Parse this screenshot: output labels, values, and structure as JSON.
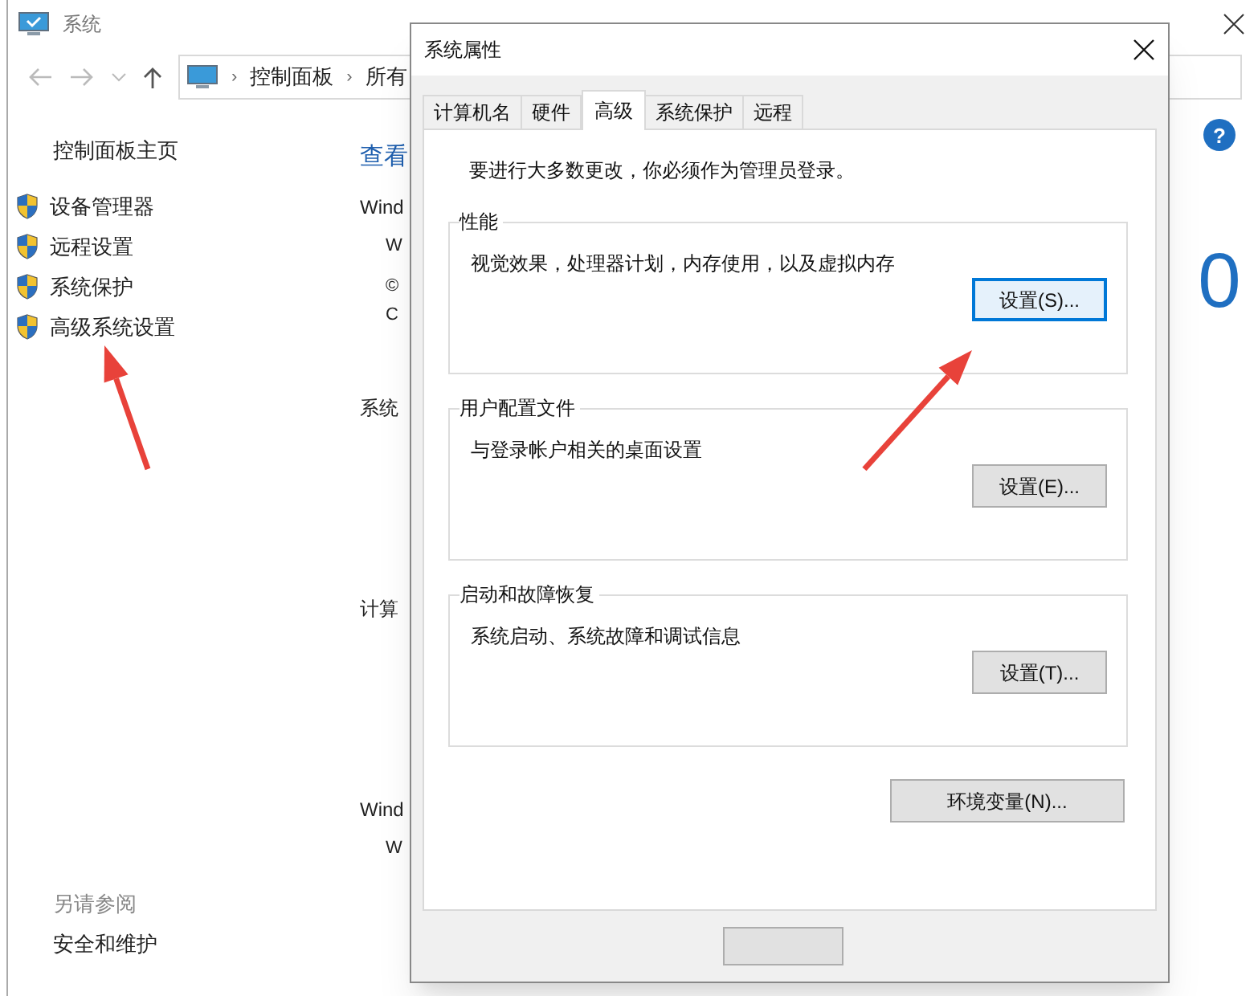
{
  "background_window": {
    "title": "系统",
    "address_bar": {
      "separator": "›",
      "path": [
        "控制面板",
        "所有"
      ]
    },
    "help_glyph": "?",
    "sidebar": {
      "home_link": "控制面板主页",
      "items": [
        {
          "label": "设备管理器"
        },
        {
          "label": "远程设置"
        },
        {
          "label": "系统保护"
        },
        {
          "label": "高级系统设置"
        }
      ],
      "see_also": {
        "heading": "另请参阅",
        "links": [
          "安全和维护"
        ]
      }
    },
    "page_heading": "查看",
    "content_sections": [
      {
        "heading": "Wind",
        "lines": [
          {
            "kind": "line",
            "text": "W"
          },
          {
            "kind": "line",
            "text": "©"
          },
          {
            "kind": "wrap",
            "text": "C"
          }
        ]
      },
      {
        "heading": "系统"
      },
      {
        "heading": "计算"
      },
      {
        "heading": "Wind",
        "lines": [
          {
            "kind": "line",
            "text": "W"
          }
        ]
      }
    ],
    "side_digit": "0"
  },
  "dialog": {
    "title": "系统属性",
    "tabs": [
      {
        "label": "计算机名",
        "selected": false
      },
      {
        "label": "硬件",
        "selected": false
      },
      {
        "label": "高级",
        "selected": true
      },
      {
        "label": "系统保护",
        "selected": false
      },
      {
        "label": "远程",
        "selected": false
      }
    ],
    "admin_notice": "要进行大多数更改，你必须作为管理员登录。",
    "groups": [
      {
        "title": "性能",
        "description": "视觉效果，处理器计划，内存使用，以及虚拟内存",
        "button": "设置(S)...",
        "focused": true
      },
      {
        "title": "用户配置文件",
        "description": "与登录帐户相关的桌面设置",
        "button": "设置(E)...",
        "focused": false
      },
      {
        "title": "启动和故障恢复",
        "description": "系统启动、系统故障和调试信息",
        "button": "设置(T)...",
        "focused": false
      }
    ],
    "env_button": "环境变量(N)..."
  }
}
